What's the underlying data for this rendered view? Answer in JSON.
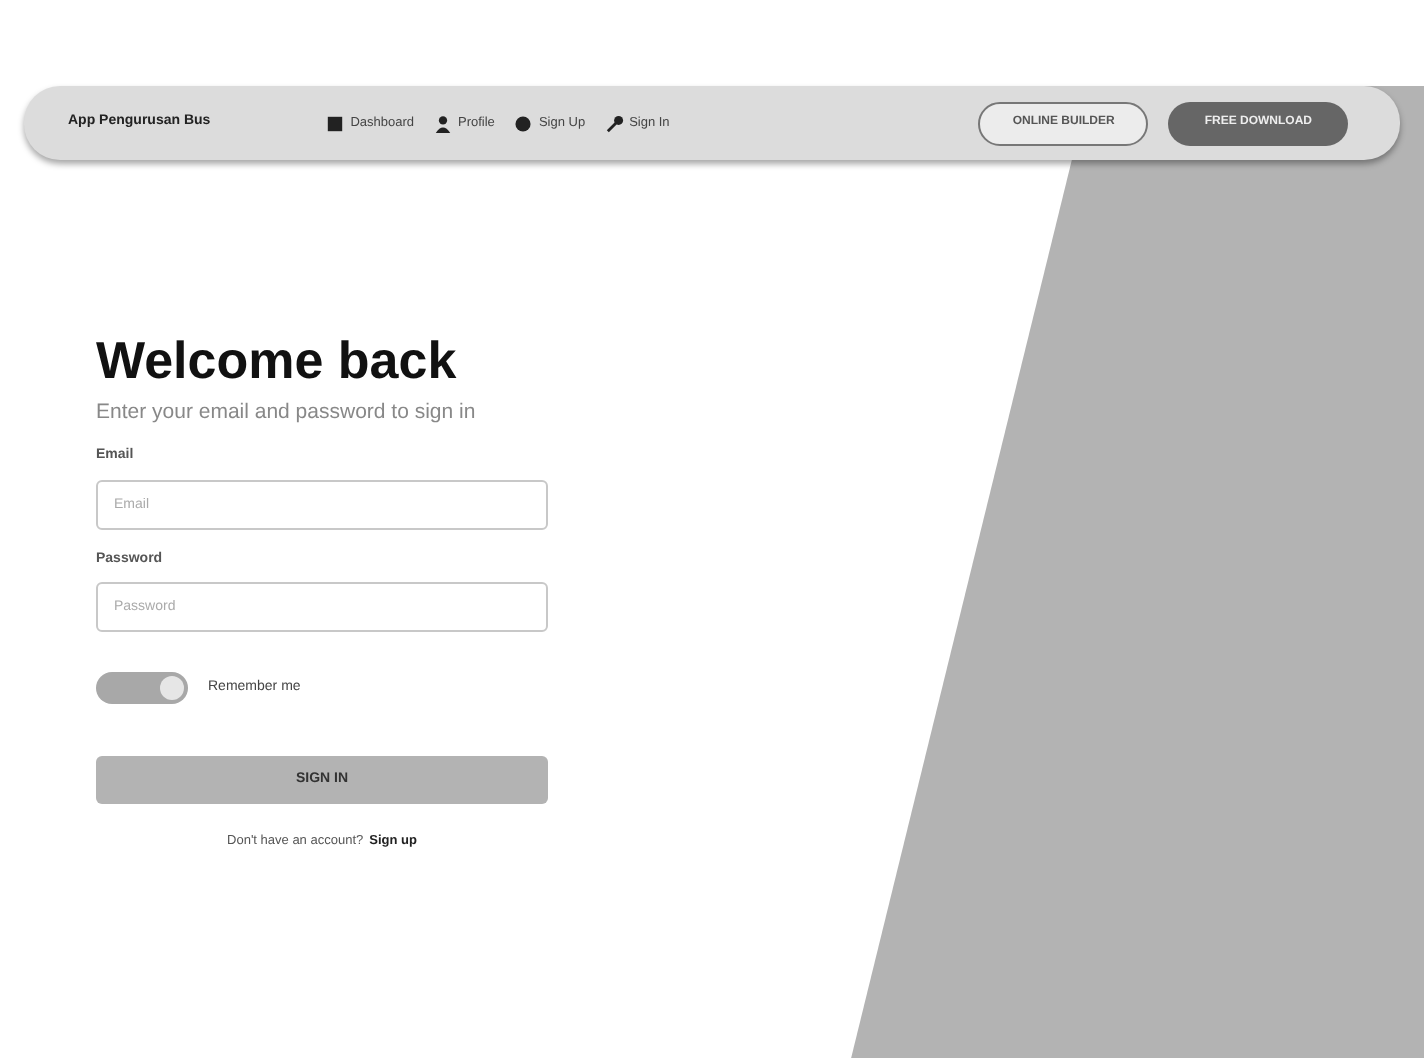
{
  "navbar": {
    "brand": "App Pengurusan Bus",
    "links": [
      {
        "kind": "dashboard",
        "label": "Dashboard"
      },
      {
        "kind": "profile",
        "label": "Profile"
      },
      {
        "kind": "signup",
        "label": "Sign Up"
      },
      {
        "kind": "signin",
        "label": "Sign In"
      }
    ],
    "buttons": [
      {
        "kind": "outline",
        "label": "ONLINE BUILDER"
      },
      {
        "kind": "solid",
        "label": "FREE DOWNLOAD"
      }
    ]
  },
  "form": {
    "title": "Welcome back",
    "subtitle": "Enter your email and password to sign in",
    "fields": [
      {
        "label": "Email",
        "placeholder": "Email"
      },
      {
        "label": "Password",
        "placeholder": "Password"
      }
    ],
    "remember": {
      "label": "Remember me",
      "on": true
    },
    "submit": "SIGN IN",
    "footer_text": "Don't have an account?",
    "footer_link": "Sign up"
  }
}
